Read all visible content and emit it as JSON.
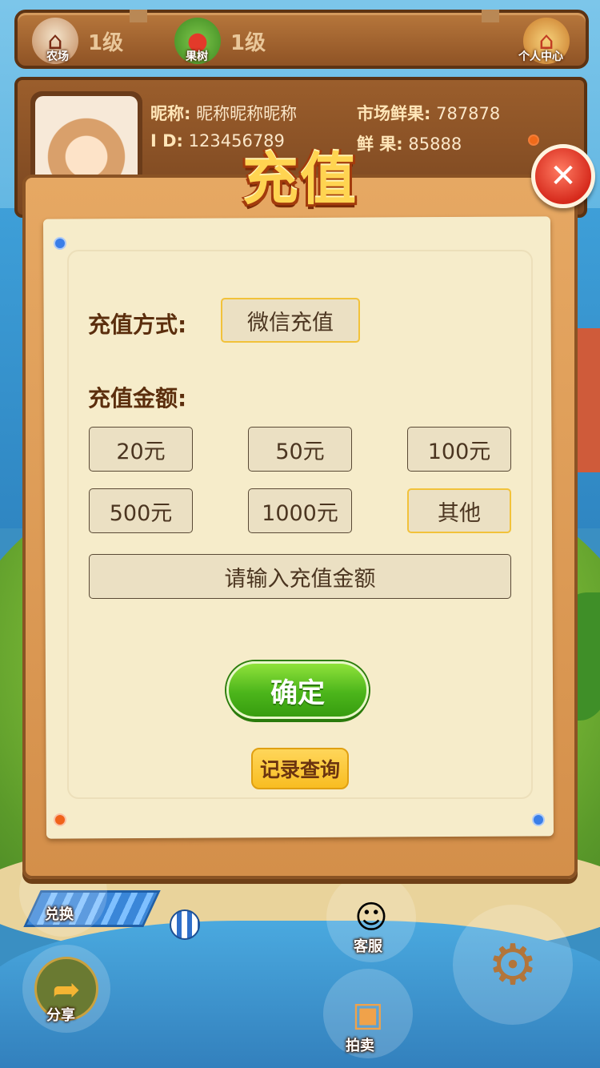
{
  "topbar": {
    "farm_label": "农场",
    "farm_level": "1级",
    "tree_label": "果树",
    "tree_level": "1级",
    "profile_center_label": "个人中心"
  },
  "profile": {
    "nickname_label": "昵称:",
    "nickname_value": "昵称昵称昵称",
    "id_label": "I  D:",
    "id_value": "123456789",
    "market_fruit_label": "市场鲜果:",
    "market_fruit_value": "787878",
    "fruit_label": "鲜   果:",
    "fruit_value": "85888"
  },
  "dialog": {
    "title": "充值",
    "method_label": "充值方式:",
    "method_value": "微信充值",
    "amount_label": "充值金额:",
    "amounts": [
      "20元",
      "50元",
      "100元",
      "500元",
      "1000元",
      "其他"
    ],
    "selected_amount": "其他",
    "amount_placeholder": "请输入充值金额",
    "confirm_label": "确定",
    "records_label": "记录查询"
  },
  "bottom_menu": {
    "exchange": "兑换",
    "service": "客服",
    "share": "分享",
    "auction": "拍卖"
  },
  "colors": {
    "wood": "#8f5325",
    "paper": "#f6ecca",
    "title": "#ffd451",
    "confirm": "#4cb51b",
    "records": "#f8bd22",
    "selected_border": "#f2c23a"
  }
}
